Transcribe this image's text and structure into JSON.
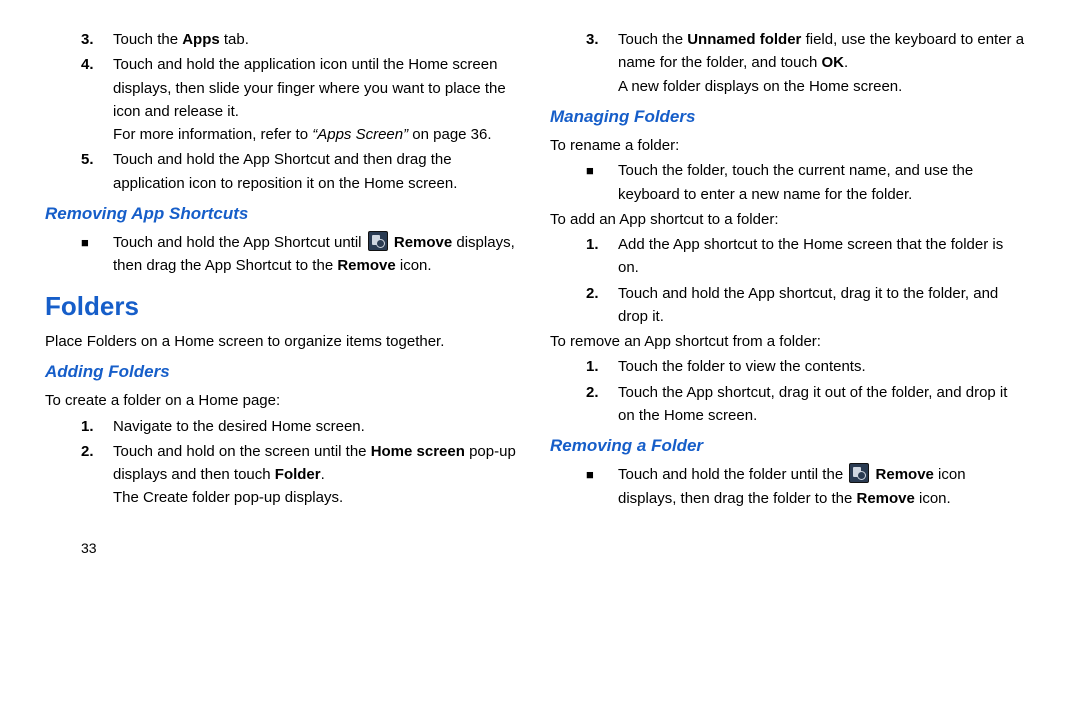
{
  "left": {
    "step3_pre": "Touch the ",
    "step3_bold": "Apps",
    "step3_post": " tab.",
    "step4": "Touch and hold the application icon until the Home screen displays, then slide your finger where you want to place the icon and release it.",
    "step4_more_pre": "For more information, refer to ",
    "step4_more_ital": "“Apps Screen”",
    "step4_more_post": " on page 36.",
    "step5": "Touch and hold the App Shortcut and then drag the application icon to reposition it on the Home screen.",
    "removing_title": "Removing App Shortcuts",
    "removing_b1_pre": "Touch and hold the App Shortcut until ",
    "removing_b1_bold1": "Remove",
    "removing_b1_mid": " displays, then drag the App Shortcut to the ",
    "removing_b1_bold2": "Remove",
    "removing_b1_post": " icon.",
    "folders_title": "Folders",
    "folders_intro": "Place Folders on a Home screen to organize items together.",
    "adding_title": "Adding Folders",
    "adding_intro": "To create a folder on a Home page:",
    "adding_s1": "Navigate to the desired Home screen.",
    "adding_s2_pre": "Touch and hold on the screen until the ",
    "adding_s2_bold1": "Home screen",
    "adding_s2_mid": " pop-up displays and then touch ",
    "adding_s2_bold2": "Folder",
    "adding_s2_post": ".",
    "adding_s2_tail": "The Create folder pop-up displays.",
    "page_number": "33"
  },
  "right": {
    "step3_pre": "Touch the ",
    "step3_bold1": "Unnamed folder",
    "step3_mid": " field, use the keyboard to enter a name for the folder, and touch ",
    "step3_bold2": "OK",
    "step3_post": ".",
    "step3_tail": "A new folder displays on the Home screen.",
    "managing_title": "Managing Folders",
    "rename_intro": "To rename a folder:",
    "rename_b1": "Touch the folder, touch the current name, and use the keyboard to enter a new name for the folder.",
    "add_intro": "To add an App shortcut to a folder:",
    "add_s1": "Add the App shortcut to the Home screen that the folder is on.",
    "add_s2": "Touch and hold the App shortcut, drag it to the folder, and drop it.",
    "remove_intro": "To remove an App shortcut from a folder:",
    "remove_s1": "Touch the folder to view the contents.",
    "remove_s2": "Touch the App shortcut, drag it out of the folder, and drop it on the Home screen.",
    "removing_folder_title": "Removing a Folder",
    "rf_b1_pre": "Touch and hold the folder until the ",
    "rf_b1_bold1": "Remove",
    "rf_b1_mid": " icon displays, then drag the folder to the ",
    "rf_b1_bold2": "Remove",
    "rf_b1_post": " icon."
  }
}
